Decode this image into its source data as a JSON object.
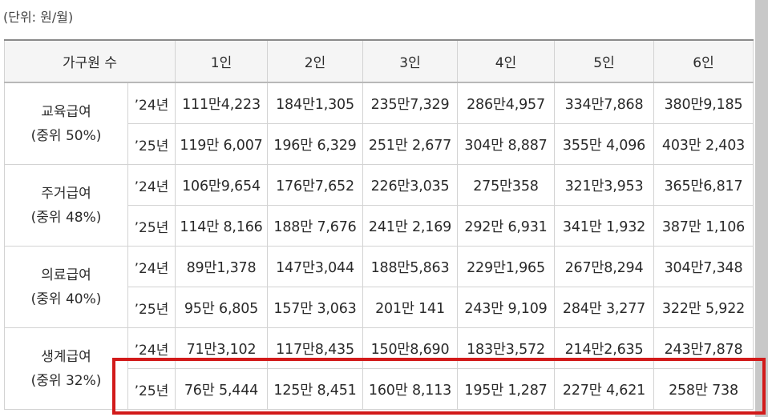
{
  "unit_note": "(단위: 원/월)",
  "header": {
    "household_label": "가구원 수",
    "sizes": [
      "1인",
      "2인",
      "3인",
      "4인",
      "5인",
      "6인"
    ]
  },
  "groups": [
    {
      "name": "교육급여",
      "ratio": "(중위 50%)",
      "rows": [
        {
          "year": "’24년",
          "values": [
            "111만4,223",
            "184만1,305",
            "235만7,329",
            "286만4,957",
            "334만7,868",
            "380만9,185"
          ]
        },
        {
          "year": "’25년",
          "values": [
            "119만 6,007",
            "196만 6,329",
            "251만 2,677",
            "304만 8,887",
            "355만 4,096",
            "403만 2,403"
          ]
        }
      ]
    },
    {
      "name": "주거급여",
      "ratio": "(중위 48%)",
      "rows": [
        {
          "year": "’24년",
          "values": [
            "106만9,654",
            "176만7,652",
            "226만3,035",
            "275만358",
            "321만3,953",
            "365만6,817"
          ]
        },
        {
          "year": "’25년",
          "values": [
            "114만 8,166",
            "188만 7,676",
            "241만 2,169",
            "292만 6,931",
            "341만 1,932",
            "387만 1,106"
          ]
        }
      ]
    },
    {
      "name": "의료급여",
      "ratio": "(중위 40%)",
      "rows": [
        {
          "year": "’24년",
          "values": [
            "89만1,378",
            "147만3,044",
            "188만5,863",
            "229만1,965",
            "267만8,294",
            "304만7,348"
          ]
        },
        {
          "year": "’25년",
          "values": [
            "95만 6,805",
            "157만 3,063",
            "201만 141",
            "243만 9,109",
            "284만 3,277",
            "322만 5,922"
          ]
        }
      ]
    },
    {
      "name": "생계급여",
      "ratio": "(중위 32%)",
      "rows": [
        {
          "year": "’24년",
          "values": [
            "71만3,102",
            "117만8,435",
            "150만8,690",
            "183만3,572",
            "214만2,635",
            "243만7,878"
          ]
        },
        {
          "year": "’25년",
          "values": [
            "76만 5,444",
            "125만 8,451",
            "160만 8,113",
            "195만 1,287",
            "227만 4,621",
            "258만 738"
          ]
        }
      ]
    }
  ],
  "highlight_color": "#d21a1a"
}
